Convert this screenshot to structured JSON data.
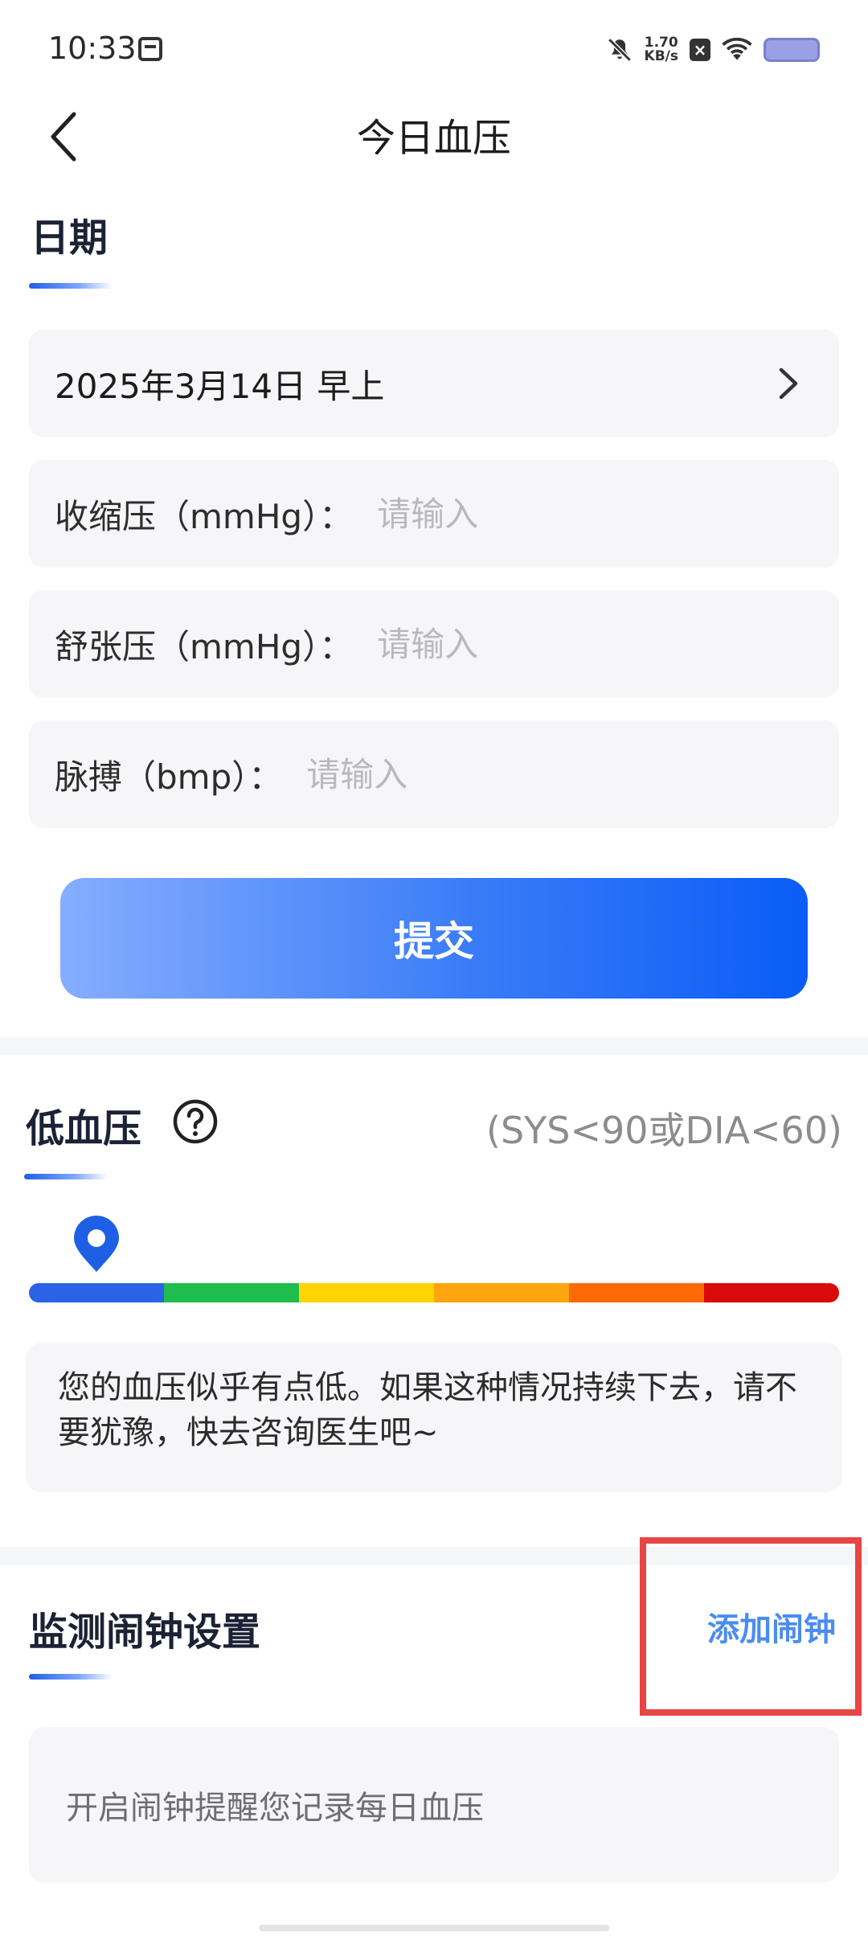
{
  "status_bar": {
    "time": "10:33",
    "net_speed_value": "1.70",
    "net_speed_unit": "KB/s"
  },
  "header": {
    "title": "今日血压"
  },
  "date_section": {
    "title": "日期",
    "date_value": "2025年3月14日 早上",
    "fields": [
      {
        "label": "收缩压（mmHg）：",
        "placeholder": "请输入"
      },
      {
        "label": "舒张压（mmHg）：",
        "placeholder": "请输入"
      },
      {
        "label": "脉搏（bmp）：",
        "placeholder": "请输入"
      }
    ],
    "submit_label": "提交"
  },
  "result": {
    "title": "低血压",
    "range_note": "(SYS<90或DIA<60)",
    "scale_colors": [
      "#2b62e6",
      "#1ebd4e",
      "#ffd400",
      "#ffa510",
      "#ff6a06",
      "#d80a0a"
    ],
    "marker_level_segment": 1,
    "advice": "您的血压似乎有点低。如果这种情况持续下去，请不要犹豫，快去咨询医生吧~"
  },
  "alarm": {
    "title": "监测闹钟设置",
    "add_label": "添加闹钟",
    "card_text": "开启闹钟提醒您记录每日血压"
  }
}
